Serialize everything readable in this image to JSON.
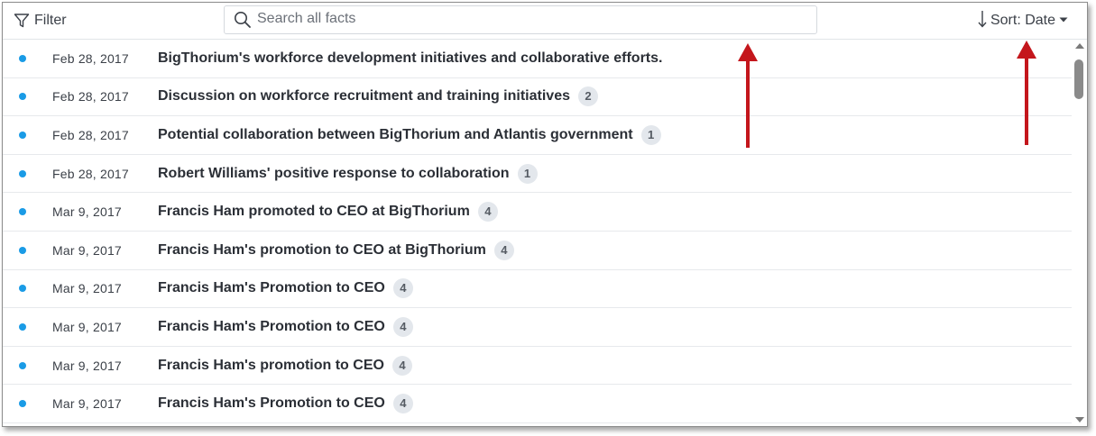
{
  "toolbar": {
    "filter_label": "Filter",
    "search_placeholder": "Search all facts",
    "search_value": "",
    "sort_label": "Sort: Date"
  },
  "facts": [
    {
      "date": "Feb 28, 2017",
      "title": "BigThorium's workforce development initiatives and collaborative efforts.",
      "count": ""
    },
    {
      "date": "Feb 28, 2017",
      "title": "Discussion on workforce recruitment and training initiatives",
      "count": "2"
    },
    {
      "date": "Feb 28, 2017",
      "title": "Potential collaboration between BigThorium and Atlantis government",
      "count": "1"
    },
    {
      "date": "Feb 28, 2017",
      "title": "Robert Williams' positive response to collaboration",
      "count": "1"
    },
    {
      "date": "Mar 9, 2017",
      "title": "Francis Ham promoted to CEO at BigThorium",
      "count": "4"
    },
    {
      "date": "Mar 9, 2017",
      "title": "Francis Ham's promotion to CEO at BigThorium",
      "count": "4"
    },
    {
      "date": "Mar 9, 2017",
      "title": "Francis Ham's Promotion to CEO",
      "count": "4"
    },
    {
      "date": "Mar 9, 2017",
      "title": "Francis Ham's Promotion to CEO",
      "count": "4"
    },
    {
      "date": "Mar 9, 2017",
      "title": "Francis Ham's promotion to CEO",
      "count": "4"
    },
    {
      "date": "Mar 9, 2017",
      "title": "Francis Ham's Promotion to CEO",
      "count": "4"
    }
  ],
  "colors": {
    "dot": "#1a9be6",
    "annotation_arrow": "#c4161c",
    "badge_bg": "#e3e7ec"
  },
  "icons": {
    "filter": "funnel-icon",
    "search": "magnifier-icon",
    "sort": "arrow-down-icon",
    "sort_caret": "caret-down-icon"
  }
}
